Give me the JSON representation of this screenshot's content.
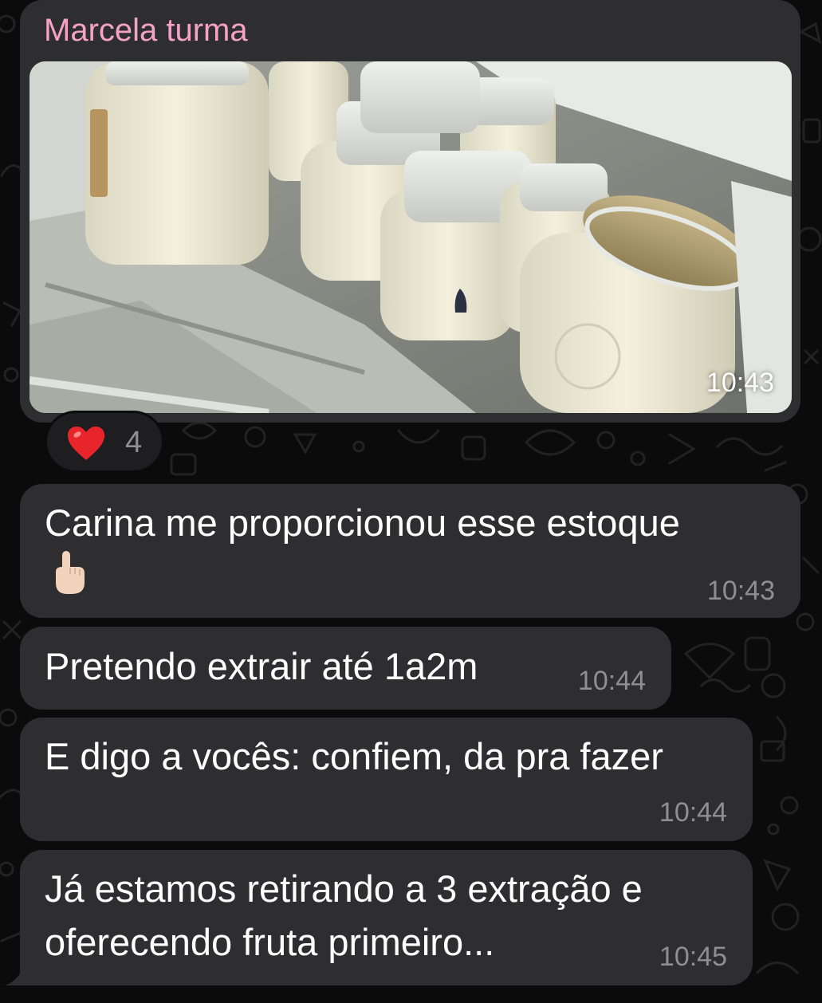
{
  "chat": {
    "sender_name": "Marcela turma",
    "photo": {
      "description_icon": "photo-freezer-milk-jars",
      "time": "10:43"
    },
    "reaction": {
      "emoji_icon": "red-heart-icon",
      "count": "4"
    },
    "messages": [
      {
        "lines": [
          "Carina me proporcionou esse estoque"
        ],
        "emoji_icon": "pointing-up-hand-icon",
        "time": "10:43"
      },
      {
        "lines": [
          "Pretendo extrair até 1a2m"
        ],
        "time": "10:44"
      },
      {
        "lines": [
          "E digo a vocês: confiem, da pra fazer"
        ],
        "time": "10:44"
      },
      {
        "lines": [
          "Já estamos retirando a 3 extração e",
          "oferecendo fruta primeiro..."
        ],
        "time": "10:45"
      }
    ]
  },
  "colors": {
    "background": "#0b0b0b",
    "bubble": "#2e2e30",
    "sender_name": "#f4a3c6",
    "timestamp": "#8e8e93",
    "text": "#ffffff"
  }
}
